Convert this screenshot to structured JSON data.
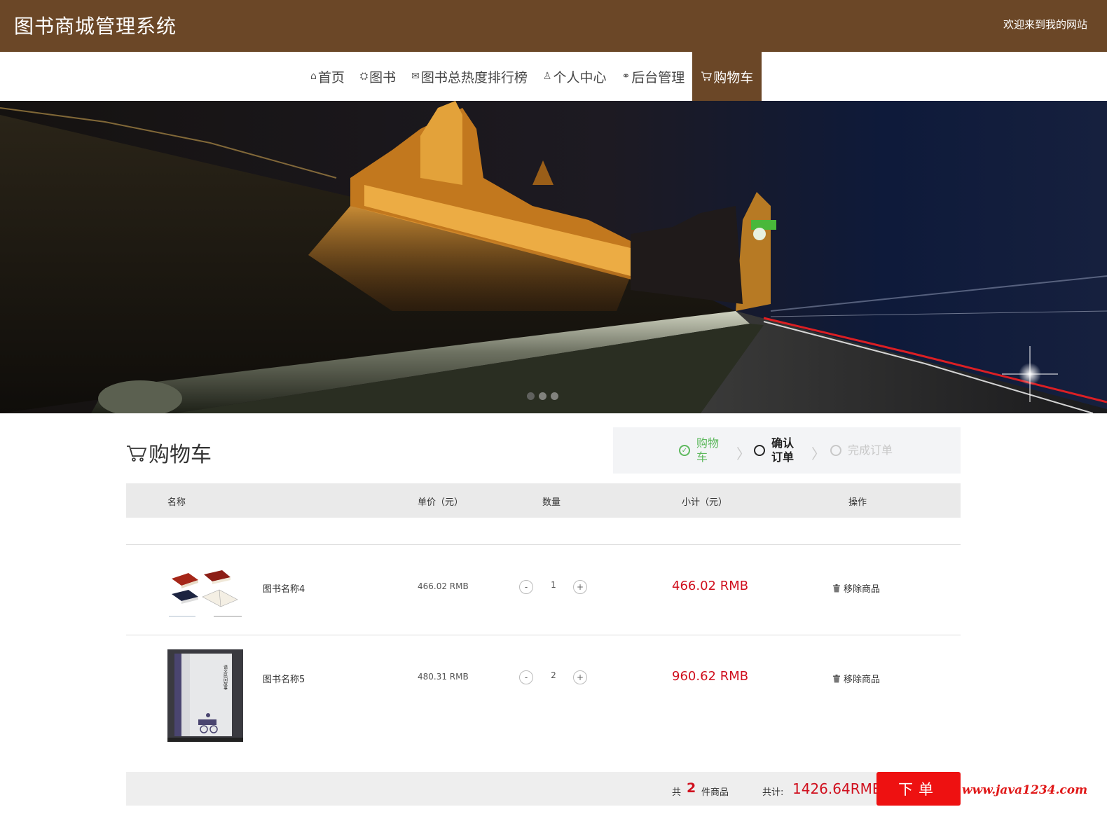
{
  "header": {
    "title": "图书商城管理系统",
    "welcome": "欢迎来到我的网站"
  },
  "nav": {
    "items": [
      {
        "label": "首页",
        "icon": "home-icon",
        "glyph": "⌂"
      },
      {
        "label": "图书",
        "icon": "book-icon",
        "glyph": "⛭"
      },
      {
        "label": "图书总热度排行榜",
        "icon": "mail-icon",
        "glyph": "✉"
      },
      {
        "label": "个人中心",
        "icon": "user-icon",
        "glyph": "♙"
      },
      {
        "label": "后台管理",
        "icon": "link-icon",
        "glyph": "⚭"
      },
      {
        "label": "购物车",
        "icon": "cart-icon",
        "glyph": "🛒",
        "active": true
      }
    ]
  },
  "banner": {
    "slides": 3,
    "active_slide": 1
  },
  "cart": {
    "title": "购物车",
    "steps": [
      {
        "label": "购物车",
        "state": "done"
      },
      {
        "label": "确认订单",
        "state": "current"
      },
      {
        "label": "完成订单",
        "state": "todo"
      }
    ],
    "columns": {
      "name": "名称",
      "unit_price": "单价（元）",
      "quantity": "数量",
      "subtotal": "小计（元）",
      "action": "操作"
    },
    "items": [
      {
        "name": "图书名称4",
        "price": "466.02 RMB",
        "quantity": "1",
        "subtotal": "466.02 RMB",
        "remove_label": "移除商品",
        "minus": "-",
        "plus": "+"
      },
      {
        "name": "图书名称5",
        "price": "480.31 RMB",
        "quantity": "2",
        "subtotal": "960.62 RMB",
        "remove_label": "移除商品",
        "minus": "-",
        "plus": "+",
        "cover_text": "语文民间故事"
      }
    ],
    "summary": {
      "count_prefix": "共",
      "count": "2",
      "count_suffix": "件商品",
      "total_label": "共计:",
      "total": "1426.64RMB",
      "order_button": "下单"
    }
  },
  "watermark": "www.java1234.com",
  "colors": {
    "brand": "#6b4727",
    "accent_red": "#d0101e",
    "button_red": "#ee1111",
    "step_done": "#5cb85c"
  }
}
